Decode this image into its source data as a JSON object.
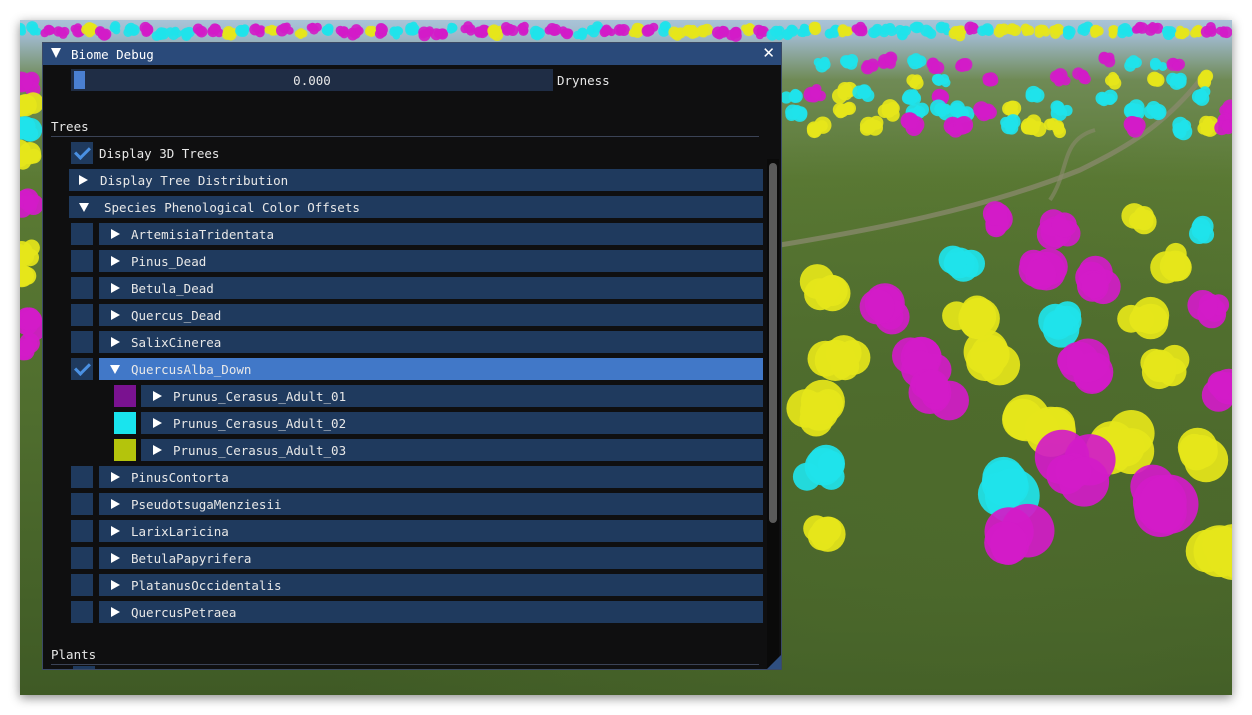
{
  "window": {
    "title": "Biome Debug",
    "close_glyph": "✕",
    "title_bar_color": "#2a4a7a",
    "accent_color": "#4178c8"
  },
  "dryness": {
    "value": "0.000",
    "label": "Dryness",
    "fill_fraction": 0.0
  },
  "trees": {
    "header": "Trees",
    "display_3d_trees": {
      "label": "Display 3D Trees",
      "checked": true
    },
    "display_tree_distribution": {
      "label": "Display Tree Distribution",
      "expanded": false
    },
    "species_offsets": {
      "label": "Species Phenological Color Offsets",
      "expanded": true,
      "species": [
        {
          "label": "ArtemisiaTridentata",
          "checked": false
        },
        {
          "label": "Pinus_Dead",
          "checked": false
        },
        {
          "label": "Betula_Dead",
          "checked": false
        },
        {
          "label": "Quercus_Dead",
          "checked": false
        },
        {
          "label": "SalixCinerea",
          "checked": false
        },
        {
          "label": "QuercusAlba_Down",
          "checked": true,
          "expanded": true,
          "selected": true,
          "children": [
            {
              "label": "Prunus_Cerasus_Adult_01",
              "color": "#7a1290"
            },
            {
              "label": "Prunus_Cerasus_Adult_02",
              "color": "#19e4ee"
            },
            {
              "label": "Prunus_Cerasus_Adult_03",
              "color": "#b4c40c"
            }
          ]
        },
        {
          "label": "PinusContorta",
          "checked": false
        },
        {
          "label": "PseudotsugaMenziesii",
          "checked": false
        },
        {
          "label": "LarixLaricina",
          "checked": false
        },
        {
          "label": "BetulaPapyrifera",
          "checked": false
        },
        {
          "label": "PlatanusOccidentalis",
          "checked": false
        },
        {
          "label": "QuercusPetraea",
          "checked": false
        }
      ]
    }
  },
  "plants": {
    "header": "Plants"
  },
  "scene_colors": [
    "#d21bc8",
    "#1fe3ea",
    "#e6e61a"
  ]
}
